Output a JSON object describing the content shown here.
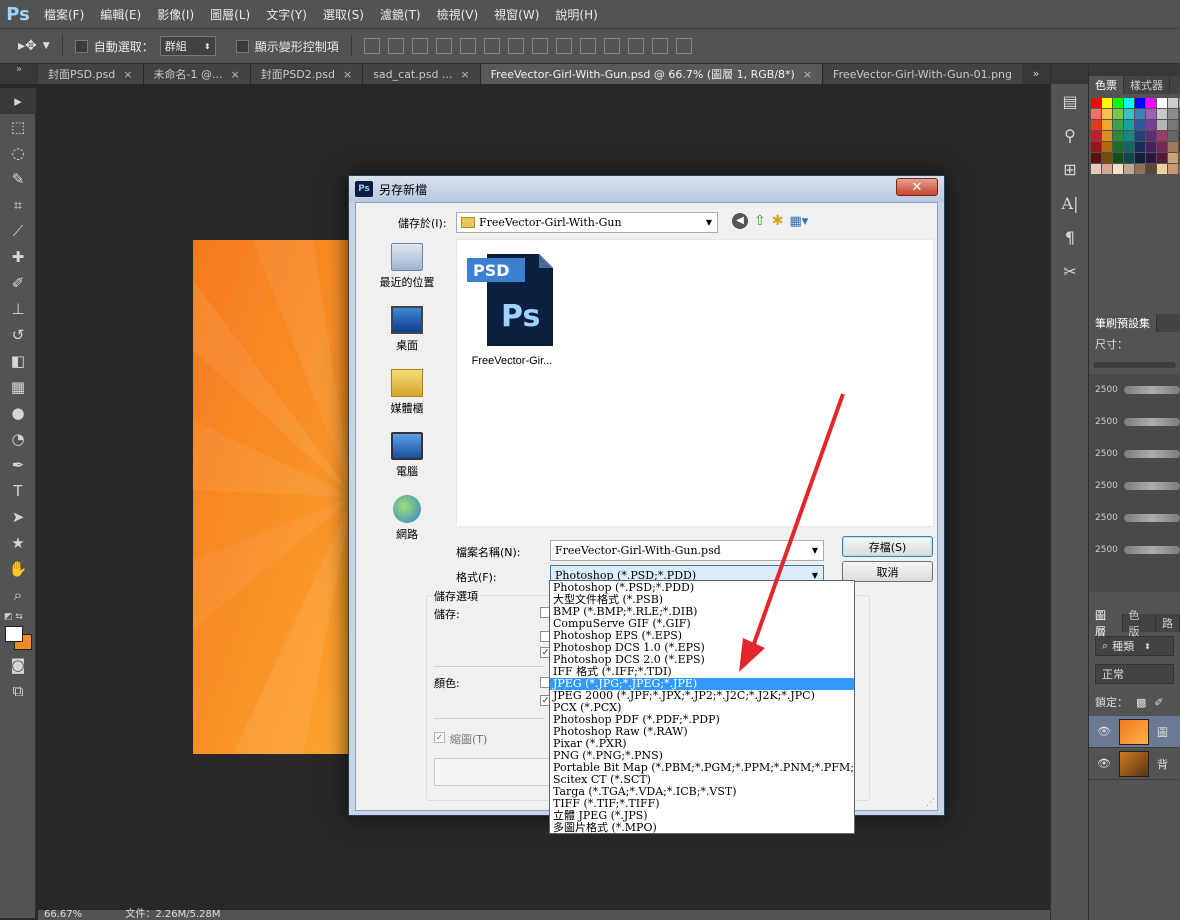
{
  "menubar": {
    "logo": "Ps",
    "items": [
      "檔案(F)",
      "編輯(E)",
      "影像(I)",
      "圖層(L)",
      "文字(Y)",
      "選取(S)",
      "濾鏡(T)",
      "檢視(V)",
      "視窗(W)",
      "說明(H)"
    ]
  },
  "options": {
    "auto_select_label": "自動選取：",
    "auto_select_value": "群組",
    "show_transform_label": "顯示變形控制項"
  },
  "tabs": [
    {
      "label": "封面PSD.psd",
      "active": false
    },
    {
      "label": "未命名-1 @...",
      "active": false
    },
    {
      "label": "封面PSD2.psd",
      "active": false
    },
    {
      "label": "sad_cat.psd ...",
      "active": false
    },
    {
      "label": "FreeVector-Girl-With-Gun.psd @ 66.7% (圖層 1, RGB/8*)",
      "active": true
    },
    {
      "label": "FreeVector-Girl-With-Gun-01.png",
      "active": false
    }
  ],
  "status": {
    "zoom": "66.67%",
    "doc": "文件：2.26M/5.28M"
  },
  "panels": {
    "swatch_tabs": [
      "色票",
      "樣式器"
    ],
    "brush_tab": "筆刷預設集",
    "size_label": "尺寸：",
    "brush_sizes": [
      "2500",
      "2500",
      "2500",
      "2500",
      "2500",
      "2500"
    ],
    "layer_tabs": [
      "圖層",
      "色版",
      "路"
    ],
    "kind_label": "種類",
    "blend_mode": "正常",
    "lock_label": "鎖定："
  },
  "swatch_colors": [
    "#ff0000",
    "#ffff00",
    "#00ff00",
    "#00ffff",
    "#0000ff",
    "#ff00ff",
    "#ffffff",
    "#cccccc",
    "#999999",
    "#ff6f61",
    "#f7c548",
    "#7ac943",
    "#3fbfbf",
    "#3f7fbf",
    "#9f5fbf",
    "#c9c9c9",
    "#8c8c8c",
    "#5a5a5a",
    "#e6381f",
    "#f2a431",
    "#3da04a",
    "#1c9ea0",
    "#2c5aa0",
    "#7a3c9c",
    "#b5b5b5",
    "#777777",
    "#444444",
    "#c21f1f",
    "#d98c1f",
    "#2d8a3b",
    "#1a8585",
    "#243f7a",
    "#5e2a7a",
    "#9a3b6a",
    "#666666",
    "#333333",
    "#8f1a1a",
    "#b06a10",
    "#1f6b2a",
    "#126666",
    "#182d5c",
    "#45205c",
    "#7a2852",
    "#a17a5a",
    "#4d3a2c",
    "#5e1010",
    "#7a4a0a",
    "#164d1e",
    "#0c4a4a",
    "#101f40",
    "#2f1640",
    "#571a3a",
    "#c9a47a",
    "#7a5a3a",
    "#e6c9b8",
    "#d9a58f",
    "#f2e0c9",
    "#bfa68c",
    "#8c735a",
    "#59473a",
    "#f0d0a0",
    "#c89870",
    "#a06840"
  ],
  "dialog": {
    "title": "另存新檔",
    "save_in_label": "儲存於(I):",
    "save_in_value": "FreeVector-Girl-With-Gun",
    "places": [
      "最近的位置",
      "桌面",
      "媒體櫃",
      "電腦",
      "網路"
    ],
    "file_badge": "PSD",
    "file_name_short": "FreeVector-Gir...",
    "filename_label": "檔案名稱(N):",
    "filename_value": "FreeVector-Girl-With-Gun.psd",
    "format_label": "格式(F):",
    "format_value": "Photoshop (*.PSD;*.PDD)",
    "save_button": "存檔(S)",
    "cancel_button": "取消",
    "save_options": "儲存選項",
    "save_label": "儲存:",
    "color_label": "顏色:",
    "thumbnail_label": "縮圖(T)",
    "formats": [
      "Photoshop (*.PSD;*.PDD)",
      "大型文件格式 (*.PSB)",
      "BMP (*.BMP;*.RLE;*.DIB)",
      "CompuServe GIF (*.GIF)",
      "Photoshop EPS (*.EPS)",
      "Photoshop DCS 1.0 (*.EPS)",
      "Photoshop DCS 2.0 (*.EPS)",
      "IFF 格式 (*.IFF;*.TDI)",
      "JPEG (*.JPG;*.JPEG;*.JPE)",
      "JPEG 2000 (*.JPF;*.JPX;*.JP2;*.J2C;*.J2K;*.JPC)",
      "PCX (*.PCX)",
      "Photoshop PDF (*.PDF;*.PDP)",
      "Photoshop Raw (*.RAW)",
      "Pixar (*.PXR)",
      "PNG (*.PNG;*.PNS)",
      "Portable Bit Map (*.PBM;*.PGM;*.PPM;*.PNM;*.PFM;*.PAM)",
      "Scitex CT (*.SCT)",
      "Targa (*.TGA;*.VDA;*.ICB;*.VST)",
      "TIFF (*.TIF;*.TIFF)",
      "立體 JPEG (*.JPS)",
      "多圖片格式 (*.MPO)"
    ],
    "selected_format_index": 8
  },
  "accent_colors": {
    "annotation_arrow": "#e3262b",
    "selection": "#3399ff"
  }
}
